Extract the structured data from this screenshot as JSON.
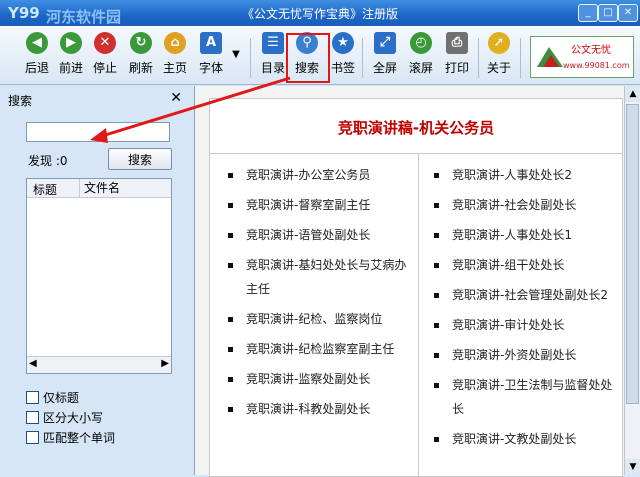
{
  "titlebar": {
    "title": "《公文无忧写作宝典》注册版",
    "logo_text": "Y99",
    "watermark": "河东软件园",
    "watermark_url": "www.pc0359.cn",
    "buttons": {
      "minimize": "_",
      "restore": "□",
      "close": "✕"
    }
  },
  "toolbar": {
    "items": [
      {
        "label": "后退",
        "icon": "back-arrow-icon",
        "color": "#3a9a3a"
      },
      {
        "label": "前进",
        "icon": "forward-arrow-icon",
        "color": "#3a9a3a"
      },
      {
        "label": "停止",
        "icon": "stop-icon",
        "color": "#d03030"
      },
      {
        "label": "刷新",
        "icon": "refresh-icon",
        "color": "#3a9a3a"
      },
      {
        "label": "主页",
        "icon": "home-icon",
        "color": "#e0a020"
      },
      {
        "label": "字体",
        "icon": "font-icon",
        "color": "#2a6fc8"
      },
      {
        "label": "目录",
        "icon": "table-of-contents-icon",
        "color": "#2a6fc8"
      },
      {
        "label": "搜索",
        "icon": "search-icon",
        "color": "#3b7fd0"
      },
      {
        "label": "书签",
        "icon": "bookmark-star-icon",
        "color": "#2a6fc8"
      },
      {
        "label": "全屏",
        "icon": "fullscreen-icon",
        "color": "#2a6fc8"
      },
      {
        "label": "滚屏",
        "icon": "autoscroll-clock-icon",
        "color": "#3a9a3a"
      },
      {
        "label": "打印",
        "icon": "printer-icon",
        "color": "#707070"
      },
      {
        "label": "关于",
        "icon": "cursor-icon",
        "color": "#e0b020"
      }
    ],
    "brand": {
      "name": "公文无忧",
      "url": "www.99081.com"
    }
  },
  "search_panel": {
    "title": "搜索",
    "close": "✕",
    "query": "",
    "found_label": "发现 :0",
    "search_button": "搜索",
    "columns": [
      "标题",
      "文件名"
    ],
    "options": [
      "仅标题",
      "区分大小写",
      "匹配整个单词"
    ]
  },
  "document": {
    "title": "竞职演讲稿-机关公务员",
    "left_items": [
      "竞职演讲-办公室公务员",
      "竞职演讲-督察室副主任",
      "竞职演讲-语管处副处长",
      "竞职演讲-基妇处处长与艾病办主任",
      "竞职演讲-纪检、监察岗位",
      "竞职演讲-纪检监察室副主任",
      "竞职演讲-监察处副处长",
      "竞职演讲-科教处副处长"
    ],
    "right_items": [
      "竞职演讲-人事处处长2",
      "竞职演讲-社会处副处长",
      "竞职演讲-人事处处长1",
      "竞职演讲-组干处处长",
      "竞职演讲-社会管理处副处长2",
      "竞职演讲-审计处处长",
      "竞职演讲-外资处副处长",
      "竞职演讲-卫生法制与监督处处长",
      "竞职演讲-文教处副处长"
    ]
  },
  "colors": {
    "title_accent": "#c00000",
    "highlight": "#e01818",
    "titlebar": "#1c66c8"
  }
}
